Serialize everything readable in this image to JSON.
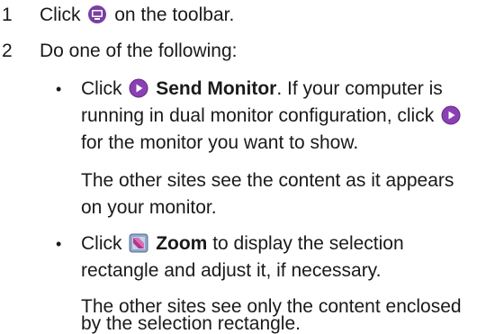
{
  "steps": [
    {
      "number": "1",
      "before_icon": "Click",
      "icon": "content-share-icon",
      "after_icon": "on the toolbar."
    },
    {
      "number": "2",
      "text": "Do one of the following:"
    }
  ],
  "options": [
    {
      "bullet": "•",
      "click": "Click",
      "icon": "send-monitor-play-icon",
      "label": "Send Monitor",
      "after_label": ". If your computer is",
      "line2": "running in dual monitor configuration, click",
      "icon2": "send-monitor-play-icon",
      "line3": "for the monitor you want to show.",
      "note_line1": "The other sites see the content as it appears",
      "note_line2": "on your monitor."
    },
    {
      "bullet": "•",
      "click": "Click",
      "icon": "zoom-icon",
      "label": "Zoom",
      "after_label": "to display the selection",
      "line2": "rectangle and adjust it, if necessary.",
      "note_line1": "The other sites see only the content enclosed",
      "note_line2": "by the selection rectangle."
    }
  ],
  "colors": {
    "text": "#1a1a1a",
    "share_icon": "#7b3fa0",
    "play_icon": "#8a3fb5",
    "zoom_icon_bg": "#8fa6c8"
  }
}
